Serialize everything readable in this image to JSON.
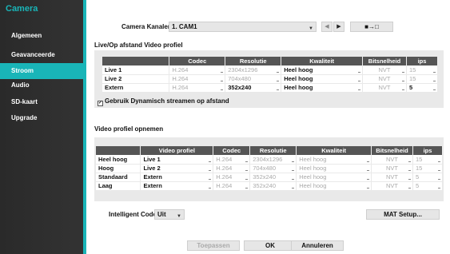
{
  "sidebar": {
    "title": "Camera",
    "items": [
      {
        "label": "Algemeen"
      },
      {
        "label": "Geavanceerde installatie"
      },
      {
        "label": "Stroom"
      },
      {
        "label": "Audio"
      },
      {
        "label": "SD-kaart"
      },
      {
        "label": "Upgrade"
      }
    ],
    "active_index": 2,
    "accent_color": "#19b5b8"
  },
  "camera_channel": {
    "label": "Camera Kanalen :",
    "value": "1. CAM1",
    "prev_icon": "chevron-left-icon",
    "next_icon": "chevron-right-icon",
    "copy_icon": "copy-settings-icon"
  },
  "live_profile": {
    "title": "Live/Op afstand Video profiel",
    "headers": [
      "",
      "Codec",
      "Resolutie",
      "Kwaliteit",
      "Bitsnelheid",
      "ips"
    ],
    "rows": [
      {
        "name": "Live 1",
        "codec": "H.264",
        "resolution": "2304x1296",
        "quality": "Heel hoog",
        "bitrate": "NVT",
        "ips": "15"
      },
      {
        "name": "Live 2",
        "codec": "H.264",
        "resolution": "704x480",
        "quality": "Heel hoog",
        "bitrate": "NVT",
        "ips": "15"
      },
      {
        "name": "Extern",
        "codec": "H.264",
        "resolution": "352x240",
        "quality": "Heel hoog",
        "bitrate": "NVT",
        "ips": "5"
      }
    ],
    "dynamic_streaming_label": "Gebruik Dynamisch streamen op afstand",
    "dynamic_streaming_checked": true
  },
  "record_profile": {
    "title": "Video profiel opnemen",
    "headers": [
      "",
      "Video profiel",
      "Codec",
      "Resolutie",
      "Kwaliteit",
      "Bitsnelheid",
      "ips"
    ],
    "rows": [
      {
        "name": "Heel hoog",
        "profile": "Live 1",
        "codec": "H.264",
        "resolution": "2304x1296",
        "quality": "Heel hoog",
        "bitrate": "NVT",
        "ips": "15"
      },
      {
        "name": "Hoog",
        "profile": "Live 2",
        "codec": "H.264",
        "resolution": "704x480",
        "quality": "Heel hoog",
        "bitrate": "NVT",
        "ips": "15"
      },
      {
        "name": "Standaard",
        "profile": "Extern",
        "codec": "H.264",
        "resolution": "352x240",
        "quality": "Heel hoog",
        "bitrate": "NVT",
        "ips": "5"
      },
      {
        "name": "Laag",
        "profile": "Extern",
        "codec": "H.264",
        "resolution": "352x240",
        "quality": "Heel hoog",
        "bitrate": "NVT",
        "ips": "5"
      }
    ]
  },
  "intelligent_codec": {
    "label": "Intelligent Codec",
    "value": "Uit"
  },
  "mat_setup_label": "MAT Setup...",
  "buttons": {
    "apply": "Toepassen",
    "ok": "OK",
    "cancel": "Annuleren"
  }
}
